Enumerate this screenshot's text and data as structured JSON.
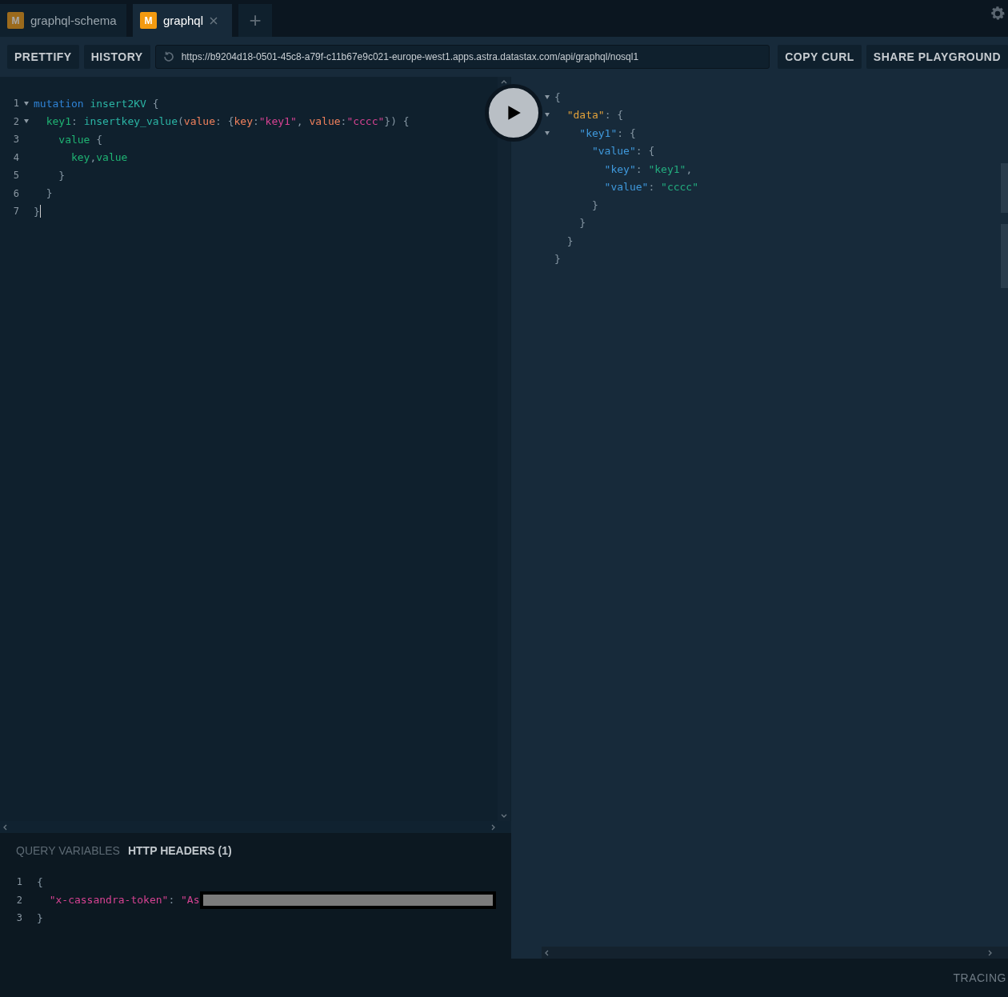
{
  "tabs": [
    {
      "badge": "M",
      "label": "graphql-schema",
      "selected": false,
      "closable": false
    },
    {
      "badge": "M",
      "label": "graphql",
      "selected": true,
      "closable": true
    }
  ],
  "new_tab": "+",
  "toolbar": {
    "buttons": [
      "PRETTIFY",
      "HISTORY"
    ],
    "url": "https://b9204d18-0501-45c8-a79f-c11b67e9c021-europe-west1.apps.astra.datastax.com/api/graphql/nosql1",
    "actions": [
      "COPY CURL",
      "SHARE PLAYGROUND"
    ]
  },
  "query_editor": {
    "lines": [
      {
        "number": "1",
        "foldable": true,
        "cursor": false,
        "tokens": [
          {
            "t": "mutation ",
            "kind": "keyword"
          },
          {
            "t": "insert2KV",
            "kind": "name"
          },
          {
            "t": " {",
            "kind": "punct"
          }
        ]
      },
      {
        "number": "2",
        "foldable": true,
        "cursor": false,
        "tokens": [
          {
            "t": "  key1",
            "kind": "field"
          },
          {
            "t": ": ",
            "kind": "punct"
          },
          {
            "t": "insertkey_value",
            "kind": "name"
          },
          {
            "t": "(",
            "kind": "punct"
          },
          {
            "t": "value",
            "kind": "argument"
          },
          {
            "t": ": {",
            "kind": "punct"
          },
          {
            "t": "key",
            "kind": "argument"
          },
          {
            "t": ":",
            "kind": "punct"
          },
          {
            "t": "\"key1\"",
            "kind": "string"
          },
          {
            "t": ", ",
            "kind": "punct"
          },
          {
            "t": "value",
            "kind": "argument"
          },
          {
            "t": ":",
            "kind": "punct"
          },
          {
            "t": "\"cccc\"",
            "kind": "string"
          },
          {
            "t": "}) {",
            "kind": "punct"
          }
        ]
      },
      {
        "number": "3",
        "foldable": false,
        "cursor": false,
        "tokens": [
          {
            "t": "    value",
            "kind": "field"
          },
          {
            "t": " {",
            "kind": "punct"
          }
        ]
      },
      {
        "number": "4",
        "foldable": false,
        "cursor": false,
        "tokens": [
          {
            "t": "      key",
            "kind": "field"
          },
          {
            "t": ",",
            "kind": "punct"
          },
          {
            "t": "value",
            "kind": "field"
          }
        ]
      },
      {
        "number": "5",
        "foldable": false,
        "cursor": false,
        "tokens": [
          {
            "t": "    }",
            "kind": "punct"
          }
        ]
      },
      {
        "number": "6",
        "foldable": false,
        "cursor": false,
        "tokens": [
          {
            "t": "  }",
            "kind": "punct"
          }
        ]
      },
      {
        "number": "7",
        "foldable": false,
        "cursor": true,
        "tokens": [
          {
            "t": "}",
            "kind": "punct"
          }
        ]
      }
    ]
  },
  "bottom_panel": {
    "tabs": [
      {
        "label": "QUERY VARIABLES",
        "selected": false
      },
      {
        "label": "HTTP HEADERS (1)",
        "selected": true
      }
    ],
    "lines": [
      {
        "number": "1",
        "tokens": [
          {
            "t": "{",
            "kind": "punct"
          }
        ]
      },
      {
        "number": "2",
        "tokens": [
          {
            "t": "  \"x-cassandra-token\"",
            "kind": "string"
          },
          {
            "t": ": ",
            "kind": "punct"
          },
          {
            "t": "\"As",
            "kind": "string"
          },
          {
            "kind": "redacted"
          }
        ]
      },
      {
        "number": "3",
        "tokens": [
          {
            "t": "}",
            "kind": "punct"
          }
        ]
      }
    ]
  },
  "result": {
    "lines": [
      {
        "foldable": true,
        "tokens": [
          {
            "t": "{",
            "kind": "punct"
          }
        ]
      },
      {
        "foldable": true,
        "tokens": [
          {
            "t": "  \"data\"",
            "kind": "jsonroot"
          },
          {
            "t": ": {",
            "kind": "punct"
          }
        ]
      },
      {
        "foldable": true,
        "tokens": [
          {
            "t": "    \"key1\"",
            "kind": "jsonkey"
          },
          {
            "t": ": {",
            "kind": "punct"
          }
        ]
      },
      {
        "foldable": false,
        "tokens": [
          {
            "t": "      \"value\"",
            "kind": "jsonkey"
          },
          {
            "t": ": {",
            "kind": "punct"
          }
        ]
      },
      {
        "foldable": false,
        "tokens": [
          {
            "t": "        \"key\"",
            "kind": "jsonkey"
          },
          {
            "t": ": ",
            "kind": "punct"
          },
          {
            "t": "\"key1\"",
            "kind": "jsonstring"
          },
          {
            "t": ",",
            "kind": "punct"
          }
        ]
      },
      {
        "foldable": false,
        "tokens": [
          {
            "t": "        \"value\"",
            "kind": "jsonkey"
          },
          {
            "t": ": ",
            "kind": "punct"
          },
          {
            "t": "\"cccc\"",
            "kind": "jsonstring"
          }
        ]
      },
      {
        "foldable": false,
        "tokens": [
          {
            "t": "      }",
            "kind": "punct"
          }
        ]
      },
      {
        "foldable": false,
        "tokens": [
          {
            "t": "    }",
            "kind": "punct"
          }
        ]
      },
      {
        "foldable": false,
        "tokens": [
          {
            "t": "  }",
            "kind": "punct"
          }
        ]
      },
      {
        "foldable": false,
        "tokens": [
          {
            "t": "}",
            "kind": "punct"
          }
        ]
      }
    ]
  },
  "footer": {
    "label": "TRACING"
  }
}
